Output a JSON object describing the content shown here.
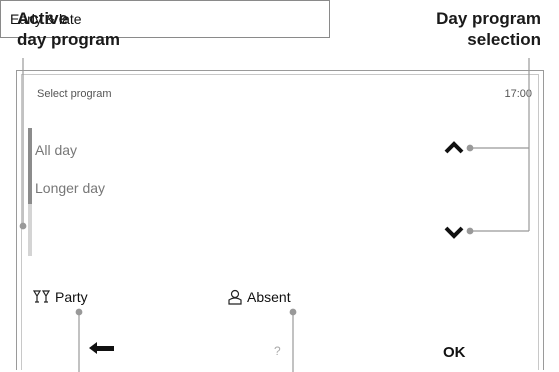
{
  "annotations": {
    "active_line1": "Active",
    "active_line2": "day program",
    "selection_line1": "Day program",
    "selection_line2": "selection"
  },
  "header": {
    "title": "Select program",
    "time": "17:00"
  },
  "programs": [
    {
      "label": "All day"
    },
    {
      "label": "Longer day"
    },
    {
      "label": "Early & late"
    }
  ],
  "buttons": {
    "party": "Party",
    "absent": "Absent",
    "help": "?",
    "ok": "OK"
  },
  "icons": {
    "party": "glasses-icon",
    "absent": "person-absent-icon",
    "up": "chevron-up-icon",
    "down": "chevron-down-icon",
    "back": "back-arrow-icon"
  }
}
